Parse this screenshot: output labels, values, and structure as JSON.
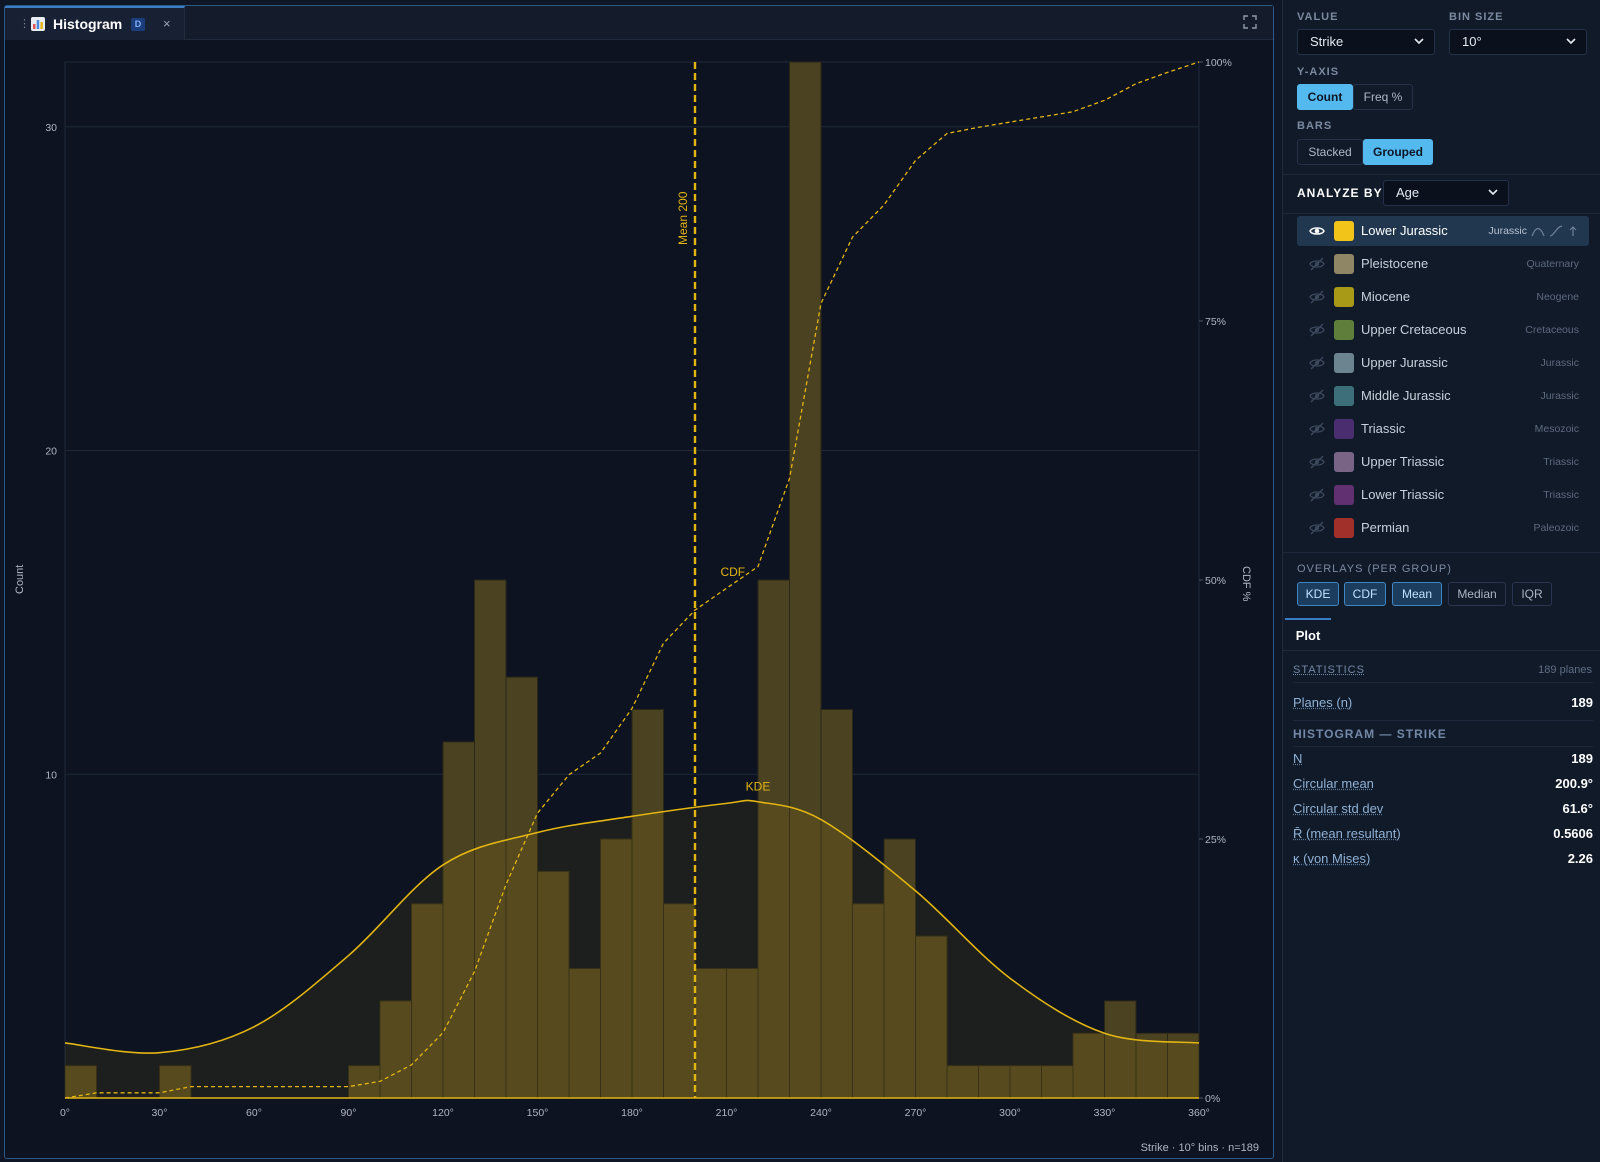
{
  "tab": {
    "title": "Histogram",
    "badge": "D",
    "close": "×",
    "drag": "⋮"
  },
  "footer_caption": "Strike · 10° bins · n=189",
  "sidebar": {
    "value": {
      "label": "VALUE",
      "selected": "Strike"
    },
    "bin_size": {
      "label": "BIN SIZE",
      "selected": "10°"
    },
    "y_axis": {
      "label": "Y-AXIS",
      "options": [
        "Count",
        "Freq %"
      ],
      "active": "Count"
    },
    "bars": {
      "label": "BARS",
      "options": [
        "Stacked",
        "Grouped"
      ],
      "active": "Grouped"
    },
    "analyze_by": {
      "label": "ANALYZE BY",
      "selected": "Age"
    },
    "groups": [
      {
        "name": "Lower Jurassic",
        "period": "Jurassic",
        "color": "#f2c318",
        "visible": true
      },
      {
        "name": "Pleistocene",
        "period": "Quaternary",
        "color": "#8f8666",
        "visible": false
      },
      {
        "name": "Miocene",
        "period": "Neogene",
        "color": "#a89a17",
        "visible": false
      },
      {
        "name": "Upper Cretaceous",
        "period": "Cretaceous",
        "color": "#5f7e3b",
        "visible": false
      },
      {
        "name": "Upper Jurassic",
        "period": "Jurassic",
        "color": "#6c8390",
        "visible": false
      },
      {
        "name": "Middle Jurassic",
        "period": "Jurassic",
        "color": "#3c6f79",
        "visible": false
      },
      {
        "name": "Triassic",
        "period": "Mesozoic",
        "color": "#4a2d6e",
        "visible": false
      },
      {
        "name": "Upper Triassic",
        "period": "Triassic",
        "color": "#7a6486",
        "visible": false
      },
      {
        "name": "Lower Triassic",
        "period": "Triassic",
        "color": "#603070",
        "visible": false
      },
      {
        "name": "Permian",
        "period": "Paleozoic",
        "color": "#a2302a",
        "visible": false
      }
    ],
    "overlays": {
      "label": "OVERLAYS (PER GROUP)",
      "buttons": [
        {
          "label": "KDE",
          "active": true
        },
        {
          "label": "CDF",
          "active": true
        },
        {
          "label": "Mean",
          "active": true
        },
        {
          "label": "Median",
          "active": false
        },
        {
          "label": "IQR",
          "active": false
        }
      ]
    },
    "plot_tab": "Plot",
    "statistics": {
      "header": "STATISTICS",
      "count_text": "189 planes",
      "planes_label": "Planes (n)",
      "planes_value": "189"
    },
    "histogram_stats": {
      "header": "HISTOGRAM — STRIKE",
      "rows": [
        {
          "label": "N",
          "value": "189"
        },
        {
          "label": "Circular mean",
          "value": "200.9°"
        },
        {
          "label": "Circular std dev",
          "value": "61.6°"
        },
        {
          "label": "R̄ (mean resultant)",
          "value": "0.5606"
        },
        {
          "label": "κ (von Mises)",
          "value": "2.26"
        }
      ]
    }
  },
  "chart_data": {
    "type": "bar",
    "xlabel": "",
    "ylabel": "Count",
    "y2label": "CDF %",
    "xlim": [
      0,
      360
    ],
    "ylim": [
      0,
      32
    ],
    "x_ticks": [
      "0°",
      "30°",
      "60°",
      "90°",
      "120°",
      "150°",
      "180°",
      "210°",
      "240°",
      "270°",
      "300°",
      "330°",
      "360°"
    ],
    "y_ticks": [
      10,
      20,
      30
    ],
    "y2_ticks": [
      "0%",
      "25%",
      "50%",
      "75%",
      "100%"
    ],
    "bin_width": 10,
    "bin_starts": [
      0,
      10,
      20,
      30,
      40,
      50,
      60,
      70,
      80,
      90,
      100,
      110,
      120,
      130,
      140,
      150,
      160,
      170,
      180,
      190,
      200,
      210,
      220,
      230,
      240,
      250,
      260,
      270,
      280,
      290,
      300,
      310,
      320,
      330,
      340,
      350
    ],
    "values": [
      1,
      0,
      0,
      1,
      0,
      0,
      0,
      0,
      0,
      1,
      3,
      6,
      11,
      16,
      13,
      7,
      4,
      8,
      12,
      6,
      4,
      4,
      16,
      32,
      12,
      6,
      8,
      5,
      1,
      1,
      1,
      1,
      2,
      3,
      2,
      2
    ],
    "series_color": "#e3b512",
    "mean": {
      "value": 200,
      "label": "Mean 200"
    },
    "kde_label": "KDE",
    "cdf_label": "CDF",
    "kde": {
      "x": [
        0,
        30,
        60,
        90,
        120,
        150,
        180,
        210,
        220,
        240,
        270,
        300,
        330,
        360
      ],
      "y": [
        1.7,
        1.4,
        2.2,
        4.4,
        7.2,
        8.2,
        8.7,
        9.1,
        9.15,
        8.6,
        6.4,
        3.7,
        2.0,
        1.7
      ]
    },
    "cdf": {
      "x": [
        0,
        10,
        30,
        40,
        90,
        100,
        110,
        120,
        130,
        140,
        150,
        160,
        170,
        180,
        190,
        200,
        210,
        220,
        230,
        240,
        250,
        260,
        270,
        280,
        290,
        300,
        310,
        320,
        330,
        340,
        350,
        360
      ],
      "y": [
        0,
        0.5,
        0.5,
        1.1,
        1.1,
        1.6,
        3.2,
        6.3,
        12.2,
        20.6,
        27.5,
        31.2,
        33.3,
        37.6,
        43.9,
        47.1,
        49.2,
        51.3,
        59.8,
        76.7,
        83.1,
        86.2,
        90.5,
        93.1,
        93.7,
        94.2,
        94.7,
        95.2,
        96.3,
        97.9,
        99.0,
        100
      ]
    }
  }
}
